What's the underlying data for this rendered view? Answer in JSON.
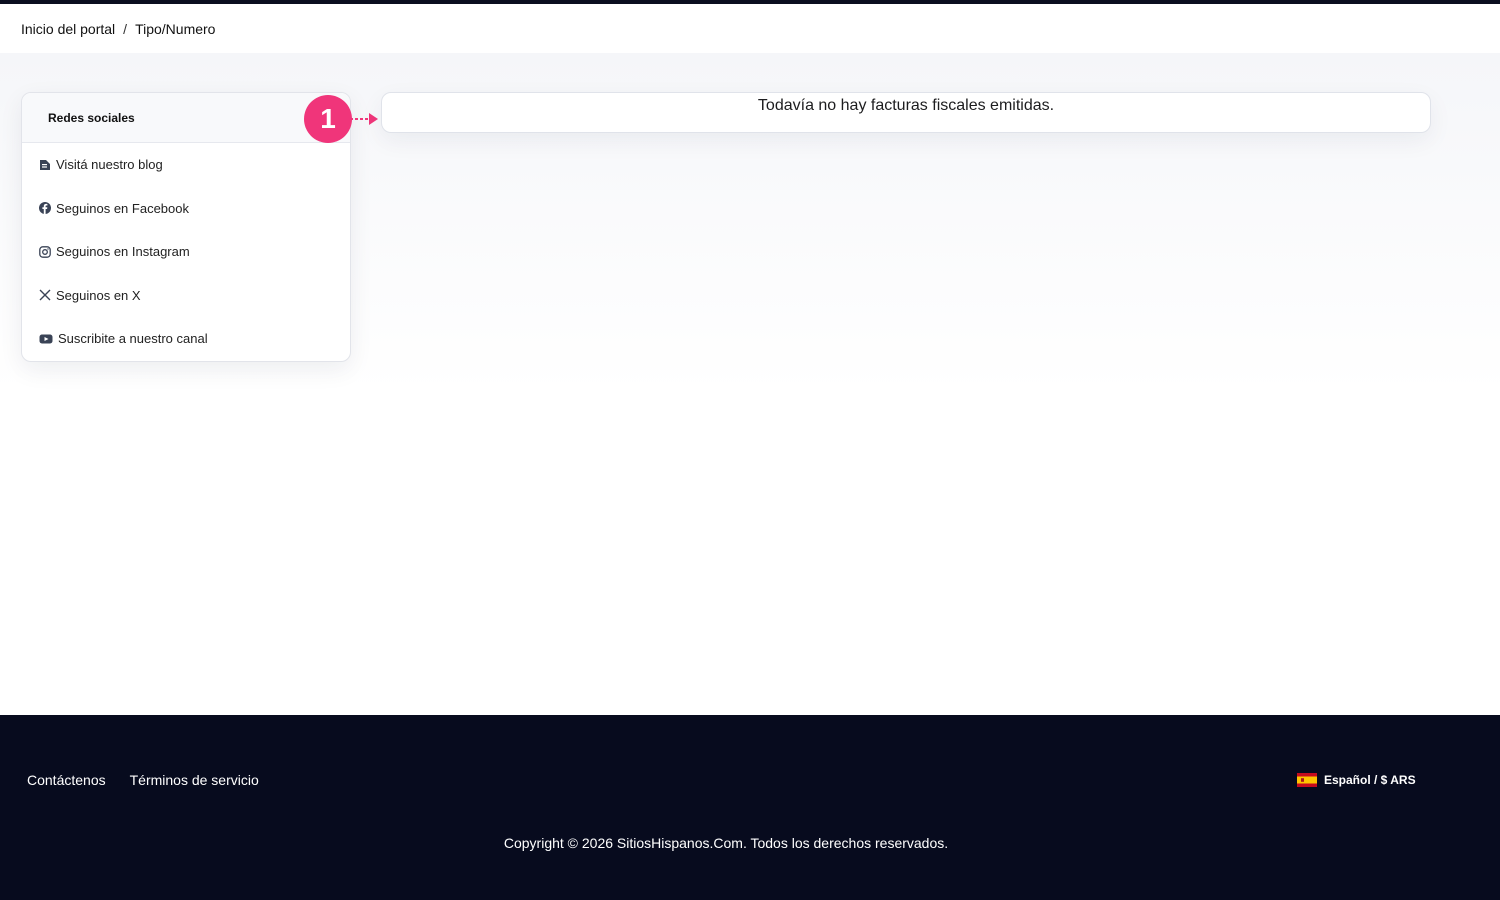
{
  "breadcrumb": {
    "home": "Inicio del portal",
    "separator": "/",
    "current": "Tipo/Numero"
  },
  "sidebar": {
    "title": "Redes sociales",
    "items": [
      {
        "label": "Visitá nuestro blog",
        "icon": "blog-icon"
      },
      {
        "label": "Seguinos en Facebook",
        "icon": "facebook-icon"
      },
      {
        "label": "Seguinos en Instagram",
        "icon": "instagram-icon"
      },
      {
        "label": "Seguinos en X",
        "icon": "x-icon"
      },
      {
        "label": "Suscribite a nuestro canal",
        "icon": "youtube-icon"
      }
    ]
  },
  "notice": {
    "message": "Todavía no hay facturas fiscales emitidas."
  },
  "annotation": {
    "number": "1",
    "color": "#f0357a"
  },
  "footer": {
    "links": [
      "Contáctenos",
      "Términos de servicio"
    ],
    "language": "Español / $ ARS",
    "flag_icon": "spain-flag-icon",
    "copyright": "Copyright © 2026 SitiosHispanos.Com. Todos los derechos reservados."
  },
  "colors": {
    "footer_bg": "#070b1e",
    "accent": "#f0357a"
  }
}
